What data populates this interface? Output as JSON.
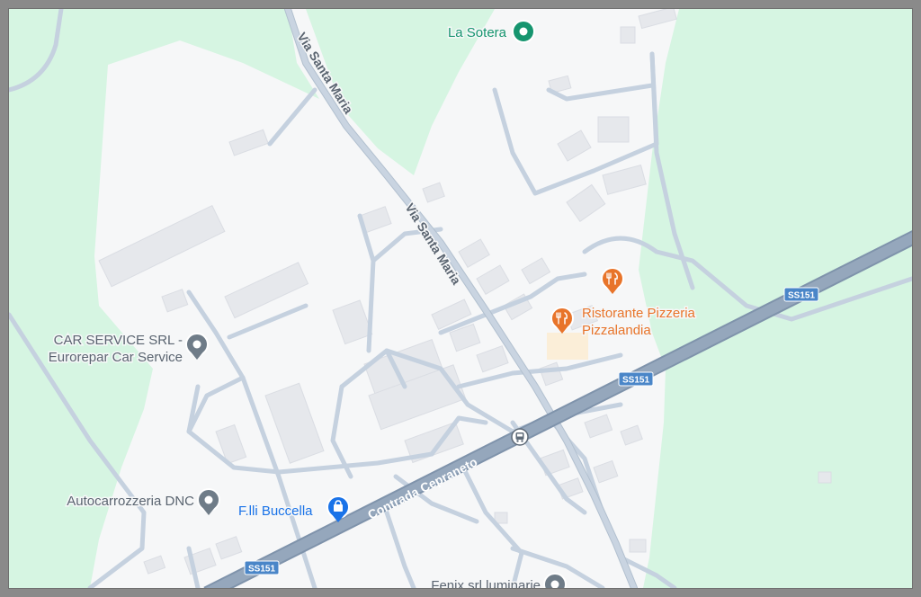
{
  "map": {
    "colors": {
      "background": "#f6f7f8",
      "green": "#d6f5e2",
      "road": "#c5d1df",
      "road_outline": "#b2c0cf",
      "highway": "#8d9fb5",
      "building": "#e6e8ec",
      "building_stroke": "#dadde3",
      "shield": "#4a86c8",
      "poi_generic": "#6f7c88",
      "poi_food": "#e8742a",
      "poi_park": "#16956f",
      "poi_shop": "#1a73e8",
      "label_text": "#5a6470"
    },
    "roads": {
      "main": "Via Santa Maria",
      "highway_name": "Contrada Cepraneto",
      "highway_ref": "SS151"
    },
    "pois": {
      "la_sotera": {
        "name": "La Sotera",
        "icon": "park-pin-icon"
      },
      "car_service_1": {
        "name": "CAR SERVICE SRL -",
        "icon": "generic-pin-icon"
      },
      "car_service_2": {
        "name": "Eurorepar Car Service"
      },
      "ristorante_1": {
        "name": "Ristorante Pizzeria",
        "icon": "restaurant-pin-icon"
      },
      "ristorante_2": {
        "name": "Pizzalandia"
      },
      "autocarrozzeria": {
        "name": "Autocarrozzeria DNC",
        "icon": "generic-pin-icon"
      },
      "buccella": {
        "name": "F.lli Buccella",
        "icon": "shopping-bag-pin-icon"
      },
      "fenix": {
        "name": "Fenix srl luminarie",
        "icon": "generic-pin-icon"
      },
      "bus_stop": {
        "icon": "bus-stop-icon"
      },
      "unnamed_restaurant": {
        "icon": "restaurant-pin-icon"
      }
    }
  }
}
